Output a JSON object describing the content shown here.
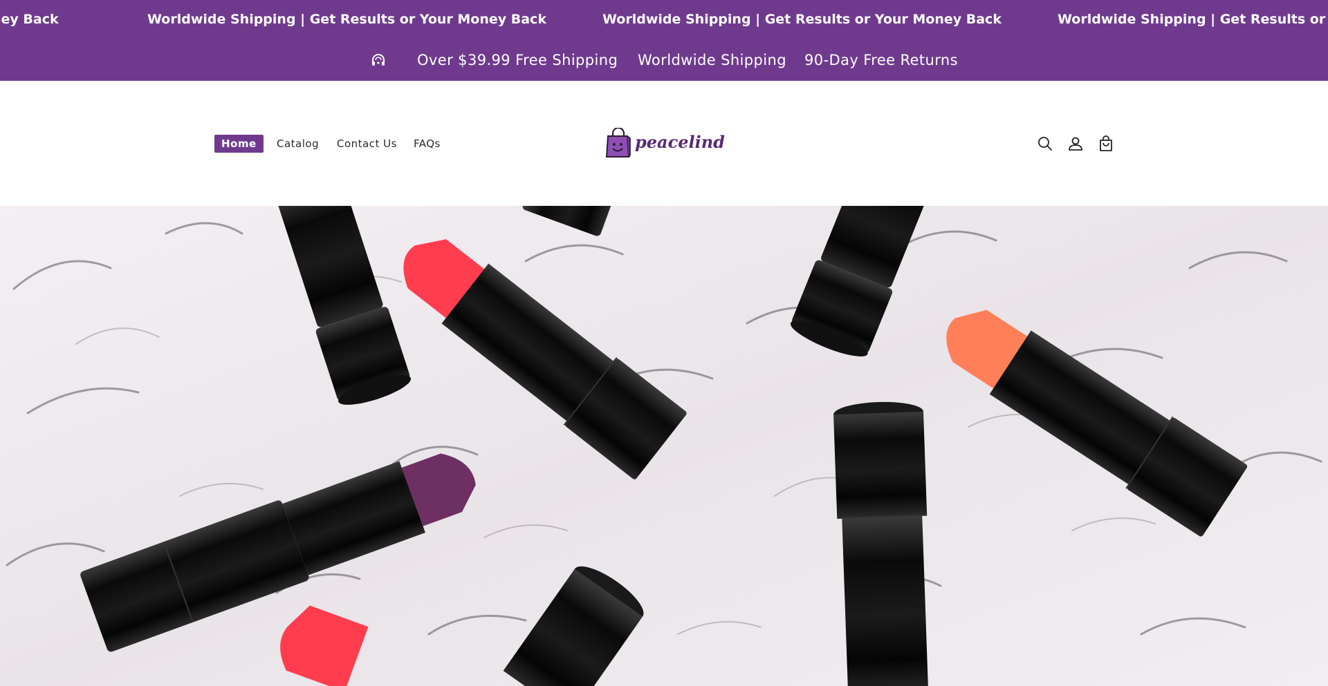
{
  "marquee": {
    "items": [
      "ney Back",
      "Worldwide Shipping | Get Results or Your Money Back",
      "Worldwide Shipping | Get Results or Your Money Back",
      "Worldwide Shipping | Get Results or Yo"
    ]
  },
  "announcement": {
    "icon": "headset-icon",
    "items": [
      "Over $39.99 Free Shipping",
      "Worldwide Shipping",
      "90-Day Free Returns"
    ]
  },
  "nav": {
    "items": [
      {
        "label": "Home",
        "active": true
      },
      {
        "label": "Catalog",
        "active": false
      },
      {
        "label": "Contact Us",
        "active": false
      },
      {
        "label": "FAQs",
        "active": false
      }
    ]
  },
  "logo": {
    "text": "peacelind",
    "icon": "shopping-bag-smile-icon"
  },
  "header_icons": [
    "search-icon",
    "account-icon",
    "cart-icon"
  ],
  "colors": {
    "brand": "#6f3a8e",
    "header_bg": "#ffffff",
    "text": "#2b2b2b"
  },
  "hero": {
    "image": "lipsticks-on-white-fur"
  }
}
